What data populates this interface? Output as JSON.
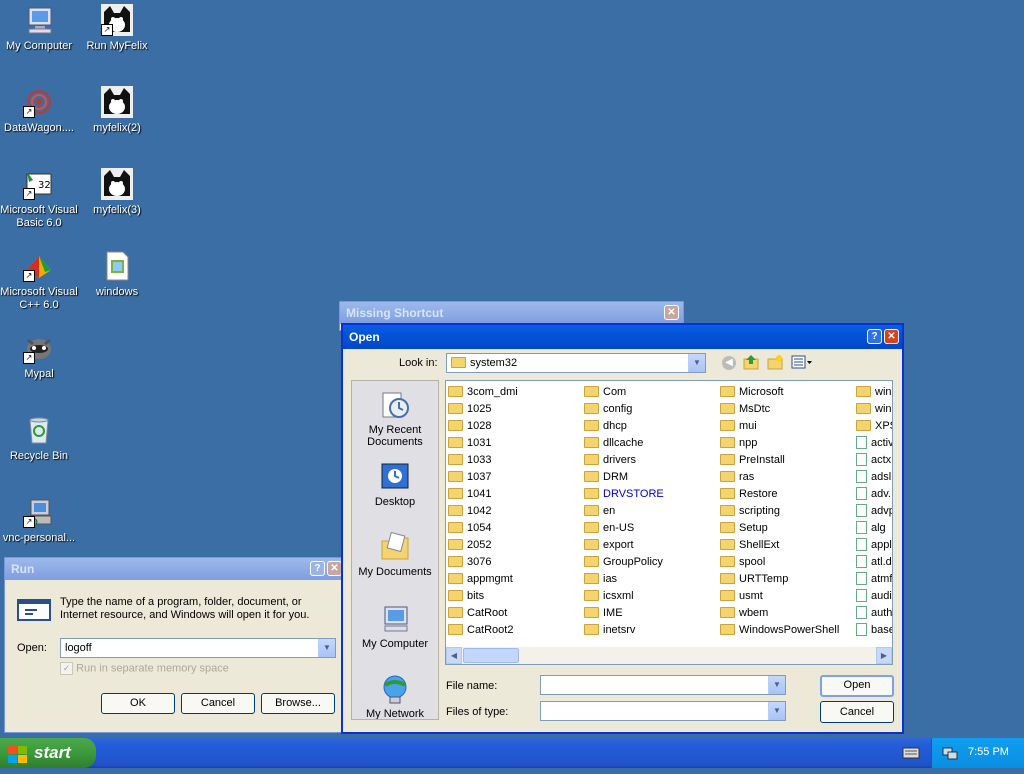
{
  "desktop": {
    "icons": [
      {
        "label": "My Computer",
        "icon": "my-computer-icon"
      },
      {
        "label": "Run MyFelix",
        "icon": "felix-cat-icon"
      },
      {
        "label": "DataWagon....",
        "icon": "datawagon-icon"
      },
      {
        "label": "myfelix(2)",
        "icon": "felix-cat-icon"
      },
      {
        "label": "Microsoft Visual Basic 6.0",
        "icon": "visual-basic-icon"
      },
      {
        "label": "myfelix(3)",
        "icon": "felix-cat-icon"
      },
      {
        "label": "Microsoft Visual C++ 6.0",
        "icon": "visual-cpp-icon"
      },
      {
        "label": "windows",
        "icon": "document-icon"
      },
      {
        "label": "Mypal",
        "icon": "mypal-icon"
      },
      {
        "label": "Recycle Bin",
        "icon": "recycle-bin-icon"
      },
      {
        "label": "vnc-personal...",
        "icon": "vnc-installer-icon"
      }
    ]
  },
  "missing_shortcut": {
    "title": "Missing Shortcut"
  },
  "run_dialog": {
    "title": "Run",
    "description": "Type the name of a program, folder, document, or Internet resource, and Windows will open it for you.",
    "open_label": "Open:",
    "open_value": "logoff",
    "separate_memory": "Run in separate memory space",
    "ok": "OK",
    "cancel": "Cancel",
    "browse": "Browse..."
  },
  "open_dialog": {
    "title": "Open",
    "look_in_label": "Look in:",
    "look_in_value": "system32",
    "places": [
      "My Recent Documents",
      "Desktop",
      "My Documents",
      "My Computer",
      "My Network"
    ],
    "columns": [
      [
        "3com_dmi",
        "1025",
        "1028",
        "1031",
        "1033",
        "1037",
        "1041",
        "1042",
        "1054",
        "2052",
        "3076",
        "appmgmt",
        "bits",
        "CatRoot",
        "CatRoot2"
      ],
      [
        "Com",
        "config",
        "dhcp",
        "dllcache",
        "drivers",
        "DRM",
        "DRVSTORE",
        "en",
        "en-US",
        "export",
        "GroupPolicy",
        "ias",
        "icsxml",
        "IME",
        "inetsrv"
      ],
      [
        "Microsoft",
        "MsDtc",
        "mui",
        "npp",
        "PreInstall",
        "ras",
        "Restore",
        "scripting",
        "Setup",
        "ShellExt",
        "spool",
        "URTTemp",
        "usmt",
        "wbem",
        "WindowsPowerShell"
      ],
      [
        "winr",
        "wins",
        "XPS",
        "activ",
        "actx",
        "adsl",
        "adv.",
        "advp",
        "alg",
        "appl",
        "atl.d",
        "atmf",
        "audi",
        "auth",
        "base"
      ]
    ],
    "file_name_label": "File name:",
    "file_name_value": "",
    "files_of_type_label": "Files of type:",
    "files_of_type_value": "",
    "open_button": "Open",
    "cancel_button": "Cancel"
  },
  "taskbar": {
    "start": "start",
    "time": "7:55 PM"
  },
  "colors": {
    "desktop": "#3a6ea5",
    "taskbar": "#245edb",
    "start": "#3c9a3c",
    "tray": "#0f8ee5"
  }
}
